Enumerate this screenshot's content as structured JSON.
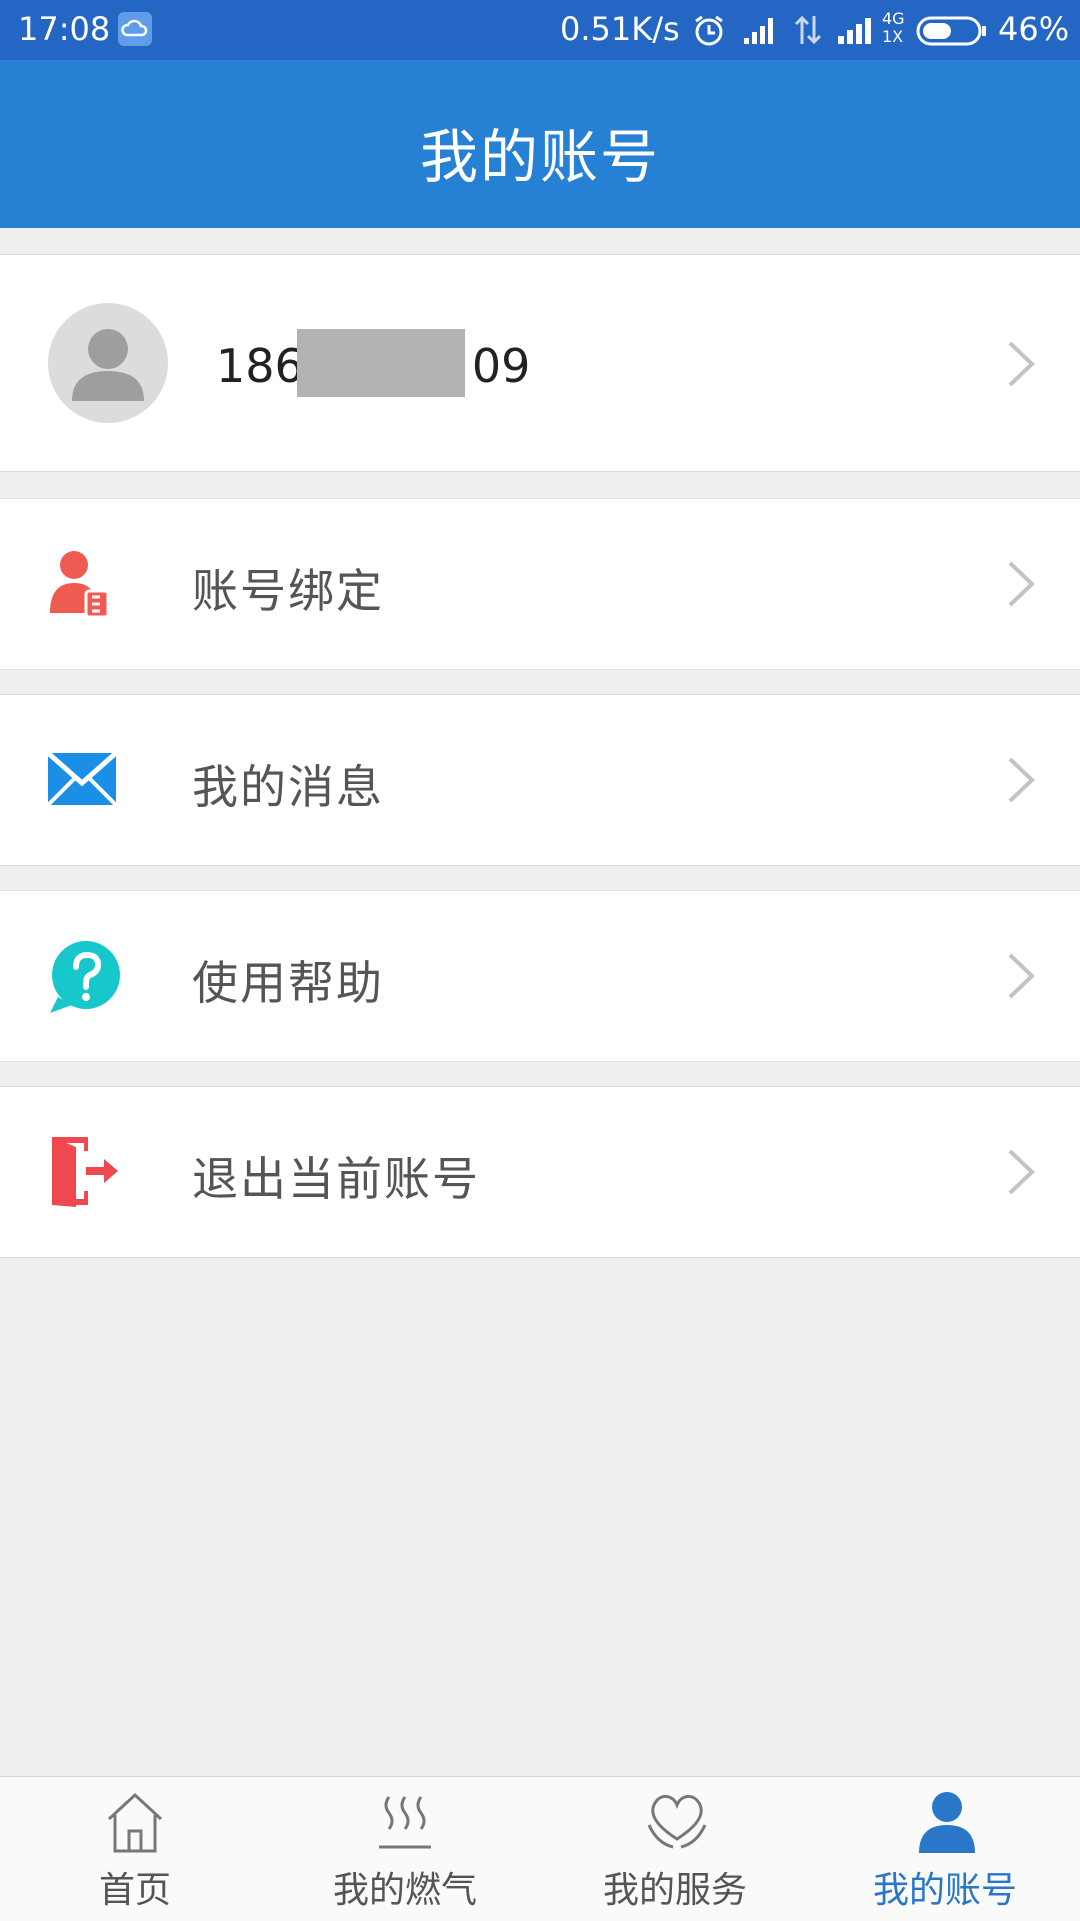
{
  "status_bar": {
    "time": "17:08",
    "net_speed": "0.51K/s",
    "network_type_top": "4G",
    "network_type_bottom": "1X",
    "battery_percent": "46%",
    "icons": [
      "cloud-icon",
      "alarm-icon",
      "signal-icon",
      "data-transfer-icon",
      "signal-icon",
      "battery-icon"
    ]
  },
  "header": {
    "title": "我的账号"
  },
  "profile": {
    "phone_prefix": "186",
    "phone_suffix": "09"
  },
  "menu": [
    {
      "label": "账号绑定",
      "icon": "user-bind-icon",
      "color": "#ef5b50"
    },
    {
      "label": "我的消息",
      "icon": "mail-icon",
      "color": "#1b8fe6"
    },
    {
      "label": "使用帮助",
      "icon": "help-icon",
      "color": "#17c7cc"
    },
    {
      "label": "退出当前账号",
      "icon": "logout-icon",
      "color": "#f0484f"
    }
  ],
  "tabbar": {
    "tabs": [
      {
        "label": "首页",
        "icon": "home-icon"
      },
      {
        "label": "我的燃气",
        "icon": "heat-icon"
      },
      {
        "label": "我的服务",
        "icon": "heart-hand-icon"
      },
      {
        "label": "我的账号",
        "icon": "user-icon",
        "active": true
      }
    ]
  },
  "colors": {
    "accent": "#2680d4",
    "statusbar": "#2466c4",
    "active_tab": "#2a76c9"
  }
}
